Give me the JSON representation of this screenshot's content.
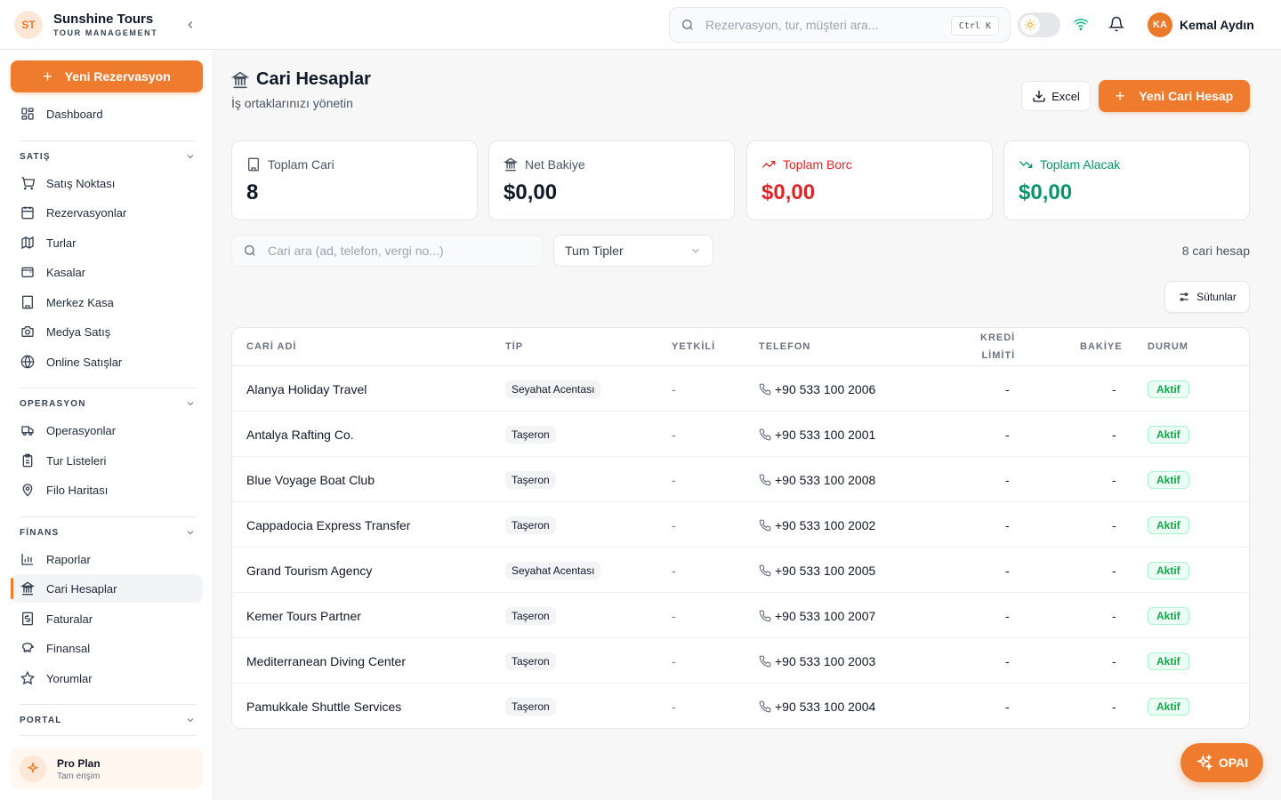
{
  "brand": {
    "initials": "ST",
    "name": "Sunshine Tours",
    "sub": "TOUR MANAGEMENT"
  },
  "search": {
    "placeholder": "Rezervasyon, tur, müşteri ara...",
    "shortcut": "Ctrl K"
  },
  "user": {
    "initials": "KA",
    "name": "Kemal Aydın"
  },
  "sidebar": {
    "new_button": "Yeni Rezervasyon",
    "dashboard": "Dashboard",
    "sections": {
      "satis": {
        "title": "SATIŞ",
        "items": [
          "Satış Noktası",
          "Rezervasyonlar",
          "Turlar",
          "Kasalar",
          "Merkez Kasa",
          "Medya Satış",
          "Online Satışlar"
        ]
      },
      "operasyon": {
        "title": "OPERASYON",
        "items": [
          "Operasyonlar",
          "Tur Listeleri",
          "Filo Haritası"
        ]
      },
      "finans": {
        "title": "FİNANS",
        "items": [
          "Raporlar",
          "Cari Hesaplar",
          "Faturalar",
          "Finansal",
          "Yorumlar"
        ]
      },
      "portal": {
        "title": "PORTAL"
      }
    },
    "pro": {
      "title": "Pro Plan",
      "sub": "Tam erişim"
    }
  },
  "page": {
    "title": "Cari Hesaplar",
    "subtitle": "İş ortaklarınızı yönetin",
    "excel_label": "Excel",
    "new_label": "Yeni Cari Hesap"
  },
  "stats": [
    {
      "label": "Toplam Cari",
      "value": "8"
    },
    {
      "label": "Net Bakiye",
      "value": "$0,00"
    },
    {
      "label": "Toplam Borc",
      "value": "$0,00"
    },
    {
      "label": "Toplam Alacak",
      "value": "$0,00"
    }
  ],
  "filters": {
    "search_placeholder": "Cari ara (ad, telefon, vergi no...)",
    "type_selected": "Tum Tipler",
    "count": "8 cari hesap",
    "columns_label": "Sütunlar"
  },
  "table": {
    "headers": {
      "name": "CARİ ADİ",
      "type": "TİP",
      "auth": "YETKİLİ",
      "phone": "TELEFON",
      "credit_1": "KREDİ",
      "credit_2": "LİMİTİ",
      "balance": "BAKİYE",
      "status": "DURUM"
    },
    "rows": [
      {
        "name": "Alanya Holiday Travel",
        "type": "Seyahat Acentası",
        "auth": "-",
        "phone": "+90 533 100 2006",
        "credit": "-",
        "balance": "-",
        "status": "Aktif"
      },
      {
        "name": "Antalya Rafting Co.",
        "type": "Taşeron",
        "auth": "-",
        "phone": "+90 533 100 2001",
        "credit": "-",
        "balance": "-",
        "status": "Aktif"
      },
      {
        "name": "Blue Voyage Boat Club",
        "type": "Taşeron",
        "auth": "-",
        "phone": "+90 533 100 2008",
        "credit": "-",
        "balance": "-",
        "status": "Aktif"
      },
      {
        "name": "Cappadocia Express Transfer",
        "type": "Taşeron",
        "auth": "-",
        "phone": "+90 533 100 2002",
        "credit": "-",
        "balance": "-",
        "status": "Aktif"
      },
      {
        "name": "Grand Tourism Agency",
        "type": "Seyahat Acentası",
        "auth": "-",
        "phone": "+90 533 100 2005",
        "credit": "-",
        "balance": "-",
        "status": "Aktif"
      },
      {
        "name": "Kemer Tours Partner",
        "type": "Taşeron",
        "auth": "-",
        "phone": "+90 533 100 2007",
        "credit": "-",
        "balance": "-",
        "status": "Aktif"
      },
      {
        "name": "Mediterranean Diving Center",
        "type": "Taşeron",
        "auth": "-",
        "phone": "+90 533 100 2003",
        "credit": "-",
        "balance": "-",
        "status": "Aktif"
      },
      {
        "name": "Pamukkale Shuttle Services",
        "type": "Taşeron",
        "auth": "-",
        "phone": "+90 533 100 2004",
        "credit": "-",
        "balance": "-",
        "status": "Aktif"
      }
    ]
  },
  "assistant": {
    "label": "OPAI"
  },
  "colors": {
    "accent": "#ef7c2e",
    "debt": "#dc2626",
    "credit": "#059669",
    "status": "#16a34a"
  }
}
